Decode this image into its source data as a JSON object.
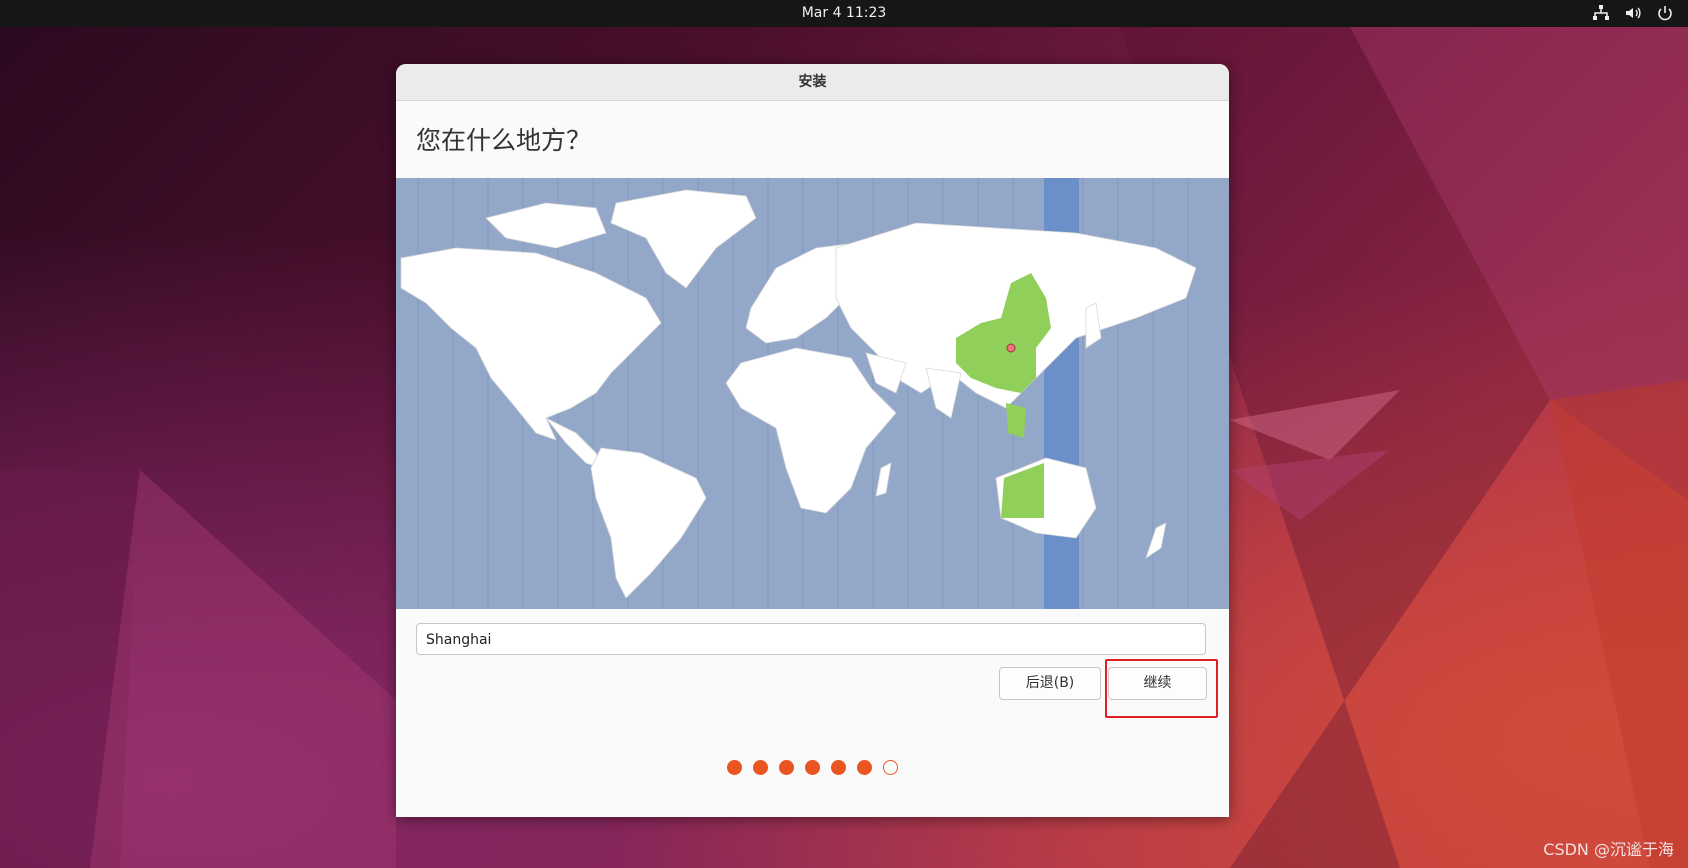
{
  "topbar": {
    "clock": "Mar 4  11:23",
    "icons": [
      "network-icon",
      "volume-icon",
      "power-icon"
    ]
  },
  "window": {
    "title": "安装",
    "heading": "您在什么地方？",
    "timezone_value": "Shanghai",
    "back_label": "后退(B)",
    "continue_label": "继续",
    "progress": {
      "total_steps": 7,
      "completed_steps": 6
    }
  },
  "colors": {
    "ocean": "#93a8c9",
    "land": "#ffffff",
    "selected_zone_land": "#8fcf5a",
    "selected_zone_band": "#6b8fc8",
    "accent": "#e95420",
    "highlight_box": "#e02020"
  },
  "watermark": "CSDN @沉谧于海"
}
